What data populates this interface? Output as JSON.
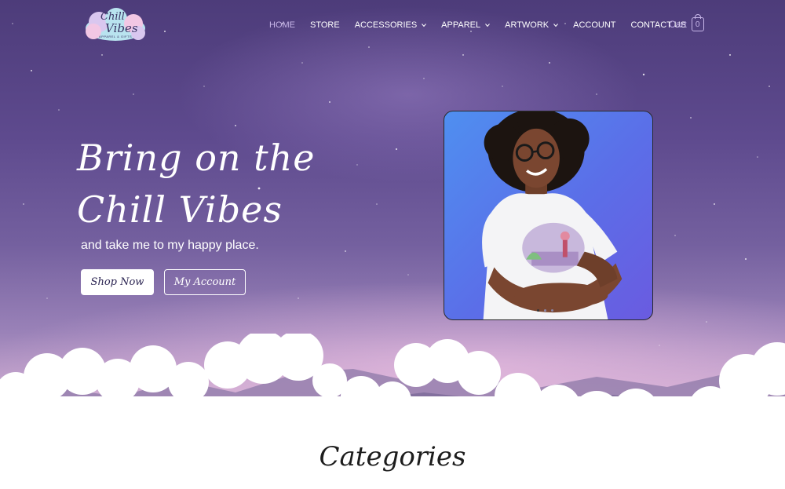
{
  "brand": {
    "logo_line1": "Chill",
    "logo_line2": "Vibes",
    "logo_tagline": "APPAREL & GIFTS"
  },
  "nav": {
    "items": [
      {
        "label": "HOME",
        "active": true,
        "has_dropdown": false
      },
      {
        "label": "STORE",
        "active": false,
        "has_dropdown": false
      },
      {
        "label": "ACCESSORIES",
        "active": false,
        "has_dropdown": true
      },
      {
        "label": "APPAREL",
        "active": false,
        "has_dropdown": true
      },
      {
        "label": "ARTWORK",
        "active": false,
        "has_dropdown": true
      },
      {
        "label": "ACCOUNT",
        "active": false,
        "has_dropdown": false
      },
      {
        "label": "CONTACT US",
        "active": false,
        "has_dropdown": false
      }
    ],
    "cart_label": "Cart",
    "cart_count": "0"
  },
  "hero": {
    "headline_line1": "Bring on the",
    "headline_line2": "Chill Vibes",
    "subline": "and take me to my happy place.",
    "shop_button": "Shop Now",
    "account_button": "My Account",
    "slider_dots": 3,
    "active_dot": 1
  },
  "section": {
    "categories_title": "Categories"
  },
  "colors": {
    "nav_active": "#c7b6e8",
    "sky_top": "#4d3c7a",
    "sky_bottom": "#d9b6d4",
    "button_text": "#2b2452"
  }
}
